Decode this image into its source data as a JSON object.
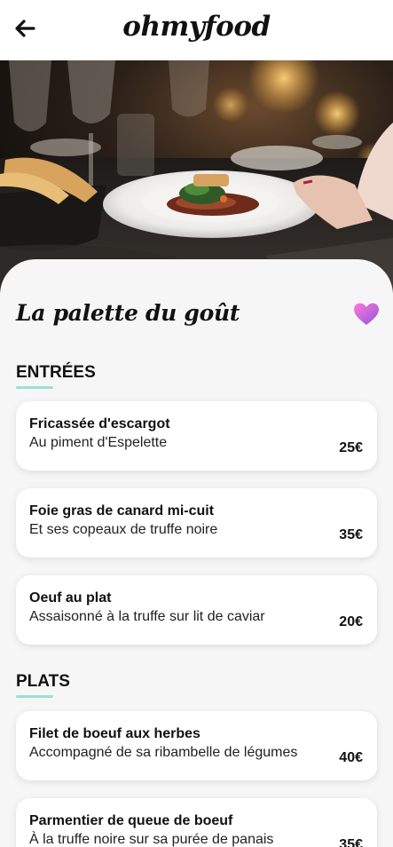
{
  "header": {
    "logo": "ohmyfood",
    "back_icon": "arrow-left-icon"
  },
  "hero": {
    "image_alt": "restaurant table with plated dish",
    "image_icon": "restaurant-photo"
  },
  "restaurant": {
    "name": "La palette du goût",
    "favorite_icon": "heart-icon"
  },
  "sections": [
    {
      "title": "ENTRÉES",
      "items": [
        {
          "name": "Fricassée d'escargot",
          "description": "Au piment d'Espelette",
          "price": "25€"
        },
        {
          "name": "Foie gras de canard mi-cuit",
          "description": "Et ses copeaux de truffe noire",
          "price": "35€"
        },
        {
          "name": "Oeuf au plat",
          "description": "Assaisonné à la truffe sur lit de caviar",
          "price": "20€"
        }
      ]
    },
    {
      "title": "PLATS",
      "items": [
        {
          "name": "Filet de boeuf aux herbes",
          "description": "Accompagné de sa ribambelle de légumes",
          "price": "40€"
        },
        {
          "name": "Parmentier de queue de boeuf",
          "description": "À la truffe noire sur sa purée de panais",
          "price": "35€"
        }
      ]
    }
  ],
  "colors": {
    "accent_underline": "#99e2d0",
    "heart_start": "#ff79da",
    "heart_end": "#9356dc",
    "background": "#f6f6f6"
  }
}
